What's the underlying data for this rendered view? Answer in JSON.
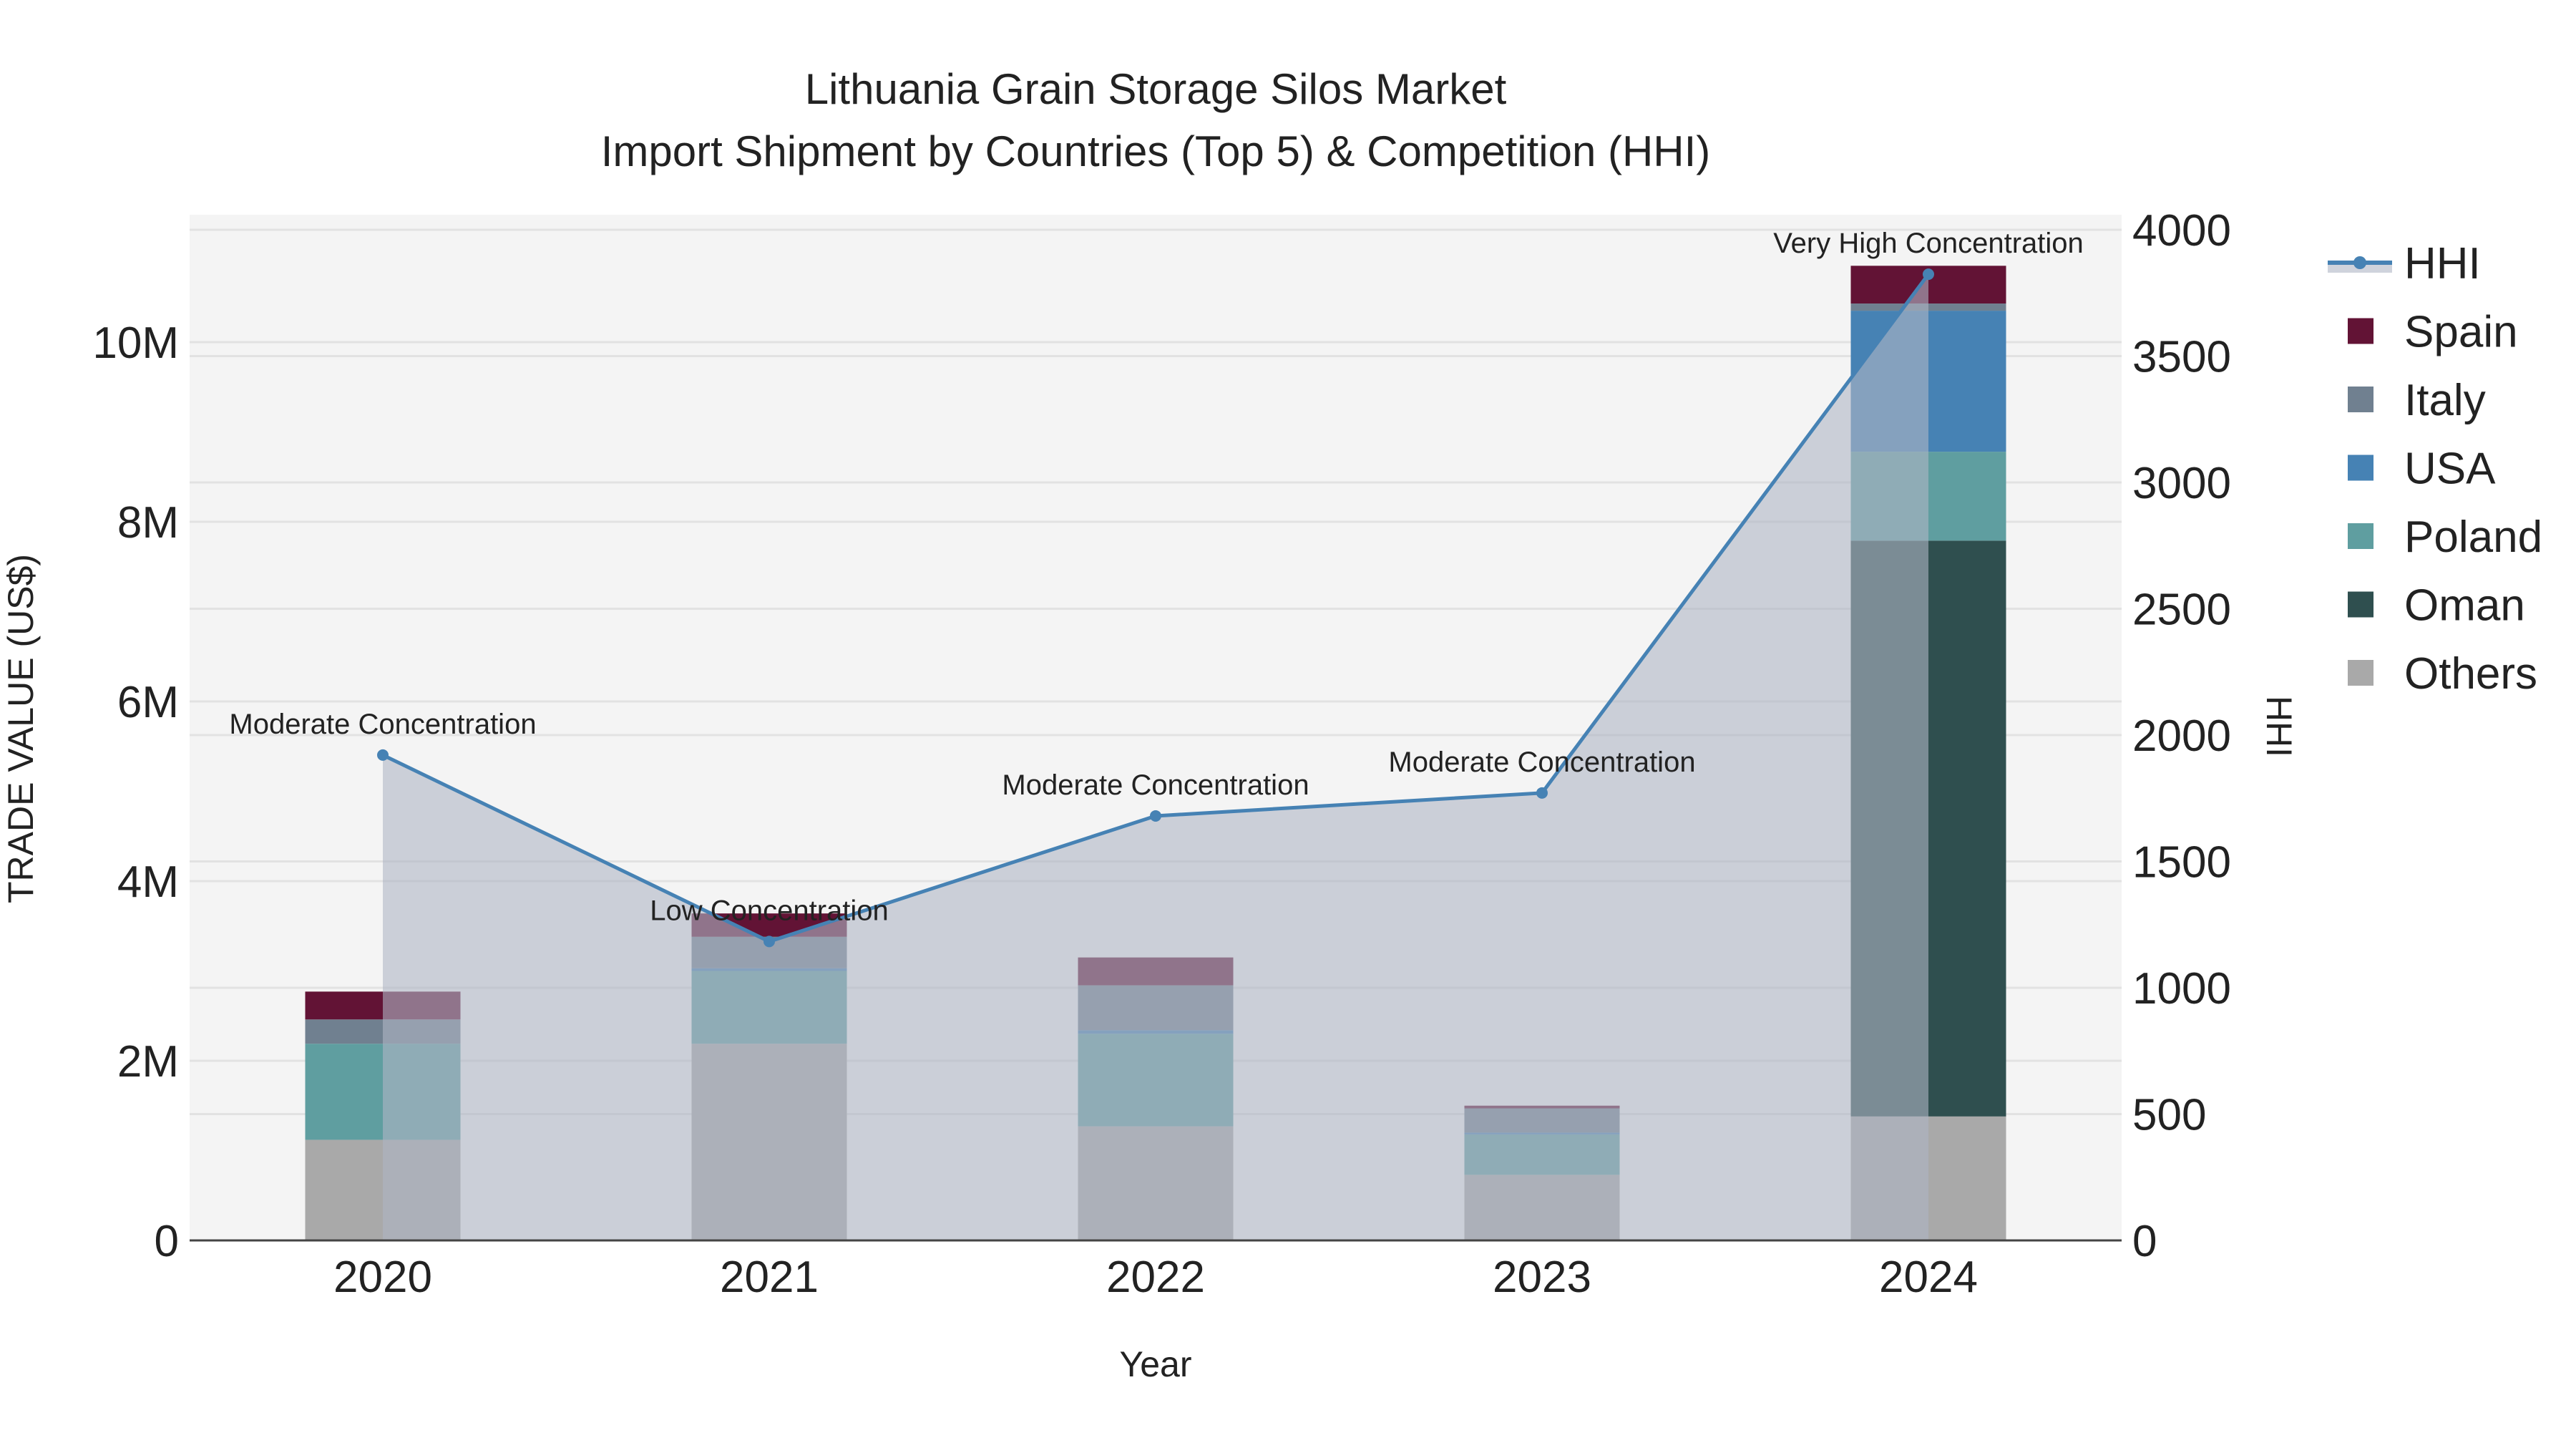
{
  "chart_data": {
    "type": "bar",
    "title_line1": "Lithuania Grain Storage Silos Market",
    "title_line2": "Import Shipment by Countries (Top 5) & Competition (HHI)",
    "xlabel": "Year",
    "ylabel": "TRADE VALUE (US$)",
    "y2label": "HHI",
    "categories": [
      "2020",
      "2021",
      "2022",
      "2023",
      "2024"
    ],
    "ylim": [
      0,
      11.2
    ],
    "y_unit": "M US$",
    "y_ticks": [
      0,
      2,
      4,
      6,
      8,
      10
    ],
    "y_tick_labels": [
      "0",
      "2M",
      "4M",
      "6M",
      "8M",
      "10M"
    ],
    "y2lim": [
      0,
      4060
    ],
    "y2_ticks": [
      0,
      500,
      1000,
      1500,
      2000,
      2500,
      3000,
      3500,
      4000
    ],
    "y2_tick_labels": [
      "0",
      "500",
      "1000",
      "1500",
      "2000",
      "2500",
      "3000",
      "3500",
      "4000"
    ],
    "grid": true,
    "legend_position": "right",
    "series": [
      {
        "name": "Others",
        "color": "#A9A9A9",
        "values": [
          1.12,
          2.19,
          1.27,
          0.73,
          1.38
        ]
      },
      {
        "name": "Oman",
        "color": "#2F4F4F",
        "values": [
          0,
          0,
          0,
          0,
          6.41
        ]
      },
      {
        "name": "Poland",
        "color": "#5F9EA0",
        "values": [
          1.07,
          0.81,
          1.03,
          0.45,
          0.99
        ]
      },
      {
        "name": "USA",
        "color": "#4682B4",
        "values": [
          0,
          0.03,
          0.04,
          0.02,
          1.57
        ]
      },
      {
        "name": "Italy",
        "color": "#708090",
        "values": [
          0.27,
          0.35,
          0.5,
          0.27,
          0.08
        ]
      },
      {
        "name": "Spain",
        "color": "#621335",
        "values": [
          0.31,
          0.26,
          0.31,
          0.03,
          0.42
        ]
      }
    ],
    "hhi": {
      "name": "HHI",
      "color": "#4682B4",
      "values": [
        1921,
        1183,
        1680,
        1771,
        3824
      ],
      "annotations": [
        "Moderate Concentration",
        "Low Concentration",
        "Moderate Concentration",
        "Moderate Concentration",
        "Very High Concentration"
      ]
    },
    "legend": [
      "HHI",
      "Spain",
      "Italy",
      "USA",
      "Poland",
      "Oman",
      "Others"
    ]
  }
}
